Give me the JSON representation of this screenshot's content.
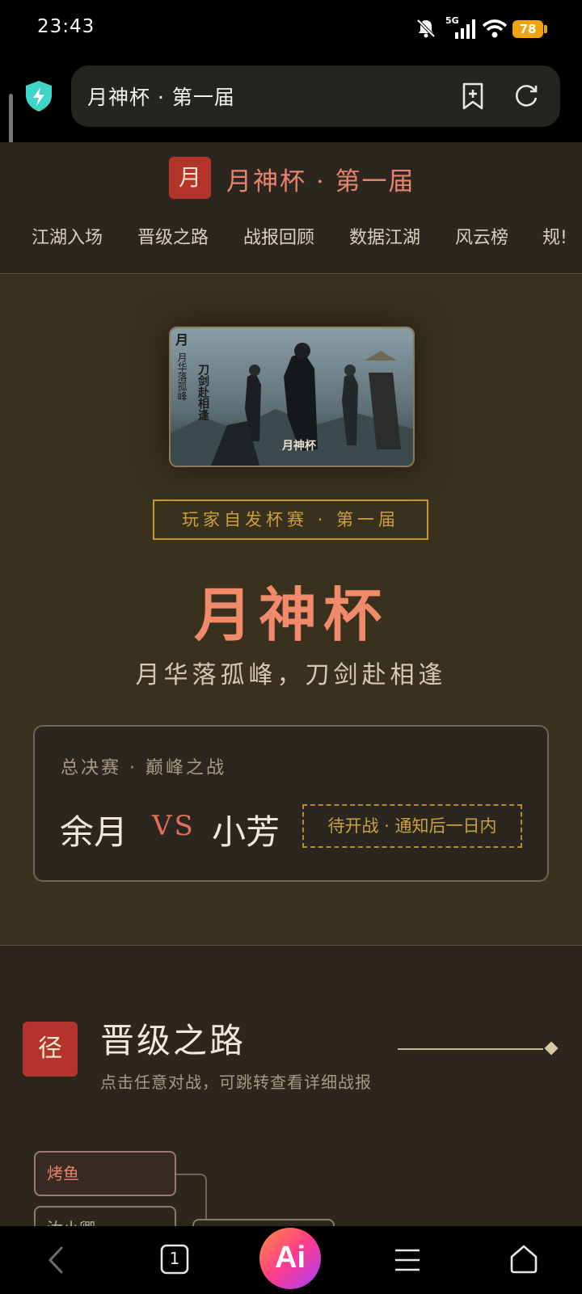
{
  "status_bar": {
    "time": "23:43",
    "network": "5G",
    "battery": "78",
    "icons": [
      "bell-off-icon",
      "signal-icon",
      "wifi-icon",
      "battery-icon"
    ]
  },
  "browser": {
    "url_title": "月神杯 · 第一届",
    "icons": [
      "shield-icon",
      "add-bookmark-icon",
      "reload-icon"
    ]
  },
  "site_header": {
    "logo_char": "月",
    "title": "月神杯 · 第一届",
    "nav": [
      "江湖入场",
      "晋级之路",
      "战报回顾",
      "数据江湖",
      "风云榜",
      "规!"
    ]
  },
  "hero": {
    "poster_alt": "月神杯",
    "poster_text": {
      "vertical_left": "月华落孤峰",
      "vertical_right": "刀剑赴相逢",
      "bottom": "月神杯"
    },
    "badge": "玩家自发杯赛 · 第一届",
    "title": "月神杯",
    "subtitle": "月华落孤峰，刀剑赴相逢",
    "final": {
      "label": "总决赛 · 巅峰之战",
      "player1": "余月",
      "vs": "VS",
      "player2": "小芳",
      "status": "待开战 · 通知后一日内"
    }
  },
  "section": {
    "icon_char": "径",
    "title": "晋级之路",
    "subtitle": "点击任意对战，可跳转查看详细战报",
    "matches": [
      "烤鱼",
      "汝小卿",
      ""
    ]
  },
  "bottom_nav": {
    "tab_count": "1",
    "ai_label": "Ai",
    "icons": [
      "back-icon",
      "tabs-icon",
      "ai-icon",
      "menu-icon",
      "home-icon"
    ]
  },
  "colors": {
    "accent_red": "#b3342a",
    "title_coral": "#f08a6a",
    "gold": "#c9a040",
    "background": "#2c261d"
  }
}
